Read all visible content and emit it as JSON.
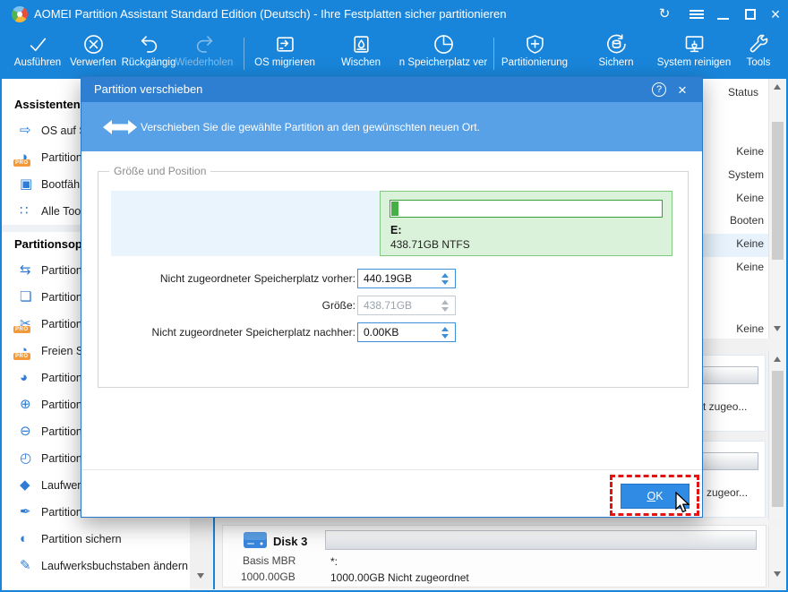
{
  "window": {
    "title": "AOMEI Partition Assistant Standard Edition (Deutsch) - Ihre Festplatten sicher partitionieren"
  },
  "toolbar": {
    "items": [
      {
        "label": "Ausführen",
        "icon": "execute-check-icon"
      },
      {
        "label": "Verwerfen",
        "icon": "discard-icon"
      },
      {
        "label": "Rückgängig",
        "icon": "undo-icon"
      },
      {
        "label": "Wiederholen",
        "icon": "redo-icon",
        "disabled": true
      },
      {
        "label": "OS migrieren",
        "icon": "migrate-os-icon"
      },
      {
        "label": "Wischen",
        "icon": "wipe-disk-icon"
      },
      {
        "label": "n Speicherplatz ver",
        "icon": "allocate-space-icon"
      },
      {
        "label": "Partitionierung",
        "icon": "partition-shield-icon"
      },
      {
        "label": "Sichern",
        "icon": "backup-icon"
      },
      {
        "label": "System reinigen",
        "icon": "clean-system-icon"
      },
      {
        "label": "Tools",
        "icon": "tools-wrench-icon"
      }
    ]
  },
  "sidebar": {
    "pro_badge": "PRO",
    "sections": [
      {
        "header": "Assistenten",
        "items": [
          {
            "label": "OS auf S",
            "icon": "migrate-os-icon"
          },
          {
            "label": "Partition",
            "icon": "clone-partition-icon",
            "pro": true
          },
          {
            "label": "Bootfähi",
            "icon": "bootable-media-icon"
          },
          {
            "label": "Alle Tool",
            "icon": "all-tools-icon"
          }
        ]
      },
      {
        "header": "Partitionsop",
        "items": [
          {
            "label": "Partition",
            "icon": "resize-partition-icon"
          },
          {
            "label": "Partition",
            "icon": "copy-partition-icon"
          },
          {
            "label": "Partition",
            "icon": "split-partition-icon",
            "pro": true
          },
          {
            "label": "Freien Sp",
            "icon": "free-space-icon",
            "pro": true
          },
          {
            "label": "Partition",
            "icon": "check-partition-icon"
          },
          {
            "label": "Partition",
            "icon": "create-partition-icon"
          },
          {
            "label": "Partition",
            "icon": "delete-partition-icon"
          },
          {
            "label": "Partition",
            "icon": "format-partition-icon"
          },
          {
            "label": "Laufwerk",
            "icon": "drive-label-icon"
          },
          {
            "label": "Partition",
            "icon": "wipe-partition-icon"
          },
          {
            "label": "Partition sichern",
            "icon": "backup-partition-icon"
          },
          {
            "label": "Laufwerksbuchstaben ändern",
            "icon": "change-letter-icon"
          }
        ]
      }
    ]
  },
  "content": {
    "status_header": "Status",
    "status_rows": [
      "Keine",
      "System",
      "Keine",
      "Booten",
      "Keine",
      "Keine",
      "Keine"
    ],
    "fragments": [
      "t zugeo...",
      "zugeor..."
    ],
    "disk3": {
      "name": "Disk 3",
      "type": "Basis MBR",
      "size": "1000.00GB",
      "partition_label": "*:",
      "partition_info": "1000.00GB Nicht zugeordnet"
    }
  },
  "dialog": {
    "title": "Partition verschieben",
    "description": "Verschieben Sie die gewählte Partition an den gewünschten neuen Ort.",
    "groupbox_label": "Größe und Position",
    "partition": {
      "label": "E:",
      "info": "438.71GB NTFS"
    },
    "fields": [
      {
        "label": "Nicht zugeordneter Speicherplatz vorher:",
        "value": "440.19GB",
        "disabled": false
      },
      {
        "label": "Größe:",
        "value": "438.71GB",
        "disabled": true
      },
      {
        "label": "Nicht zugeordneter Speicherplatz nachher:",
        "value": "0.00KB",
        "disabled": false
      }
    ],
    "ok_label": "OK"
  },
  "colors": {
    "accent_blue": "#1985da",
    "dialog_header_blue": "#2e7fd2",
    "banner_blue": "#59a1e6",
    "partition_green": "#44b044",
    "partition_green_bg": "#daf2da",
    "unallocated_blue_bg": "#e9f4fd",
    "ok_button_blue": "#2f8be4",
    "highlight_red": "#e31313"
  }
}
